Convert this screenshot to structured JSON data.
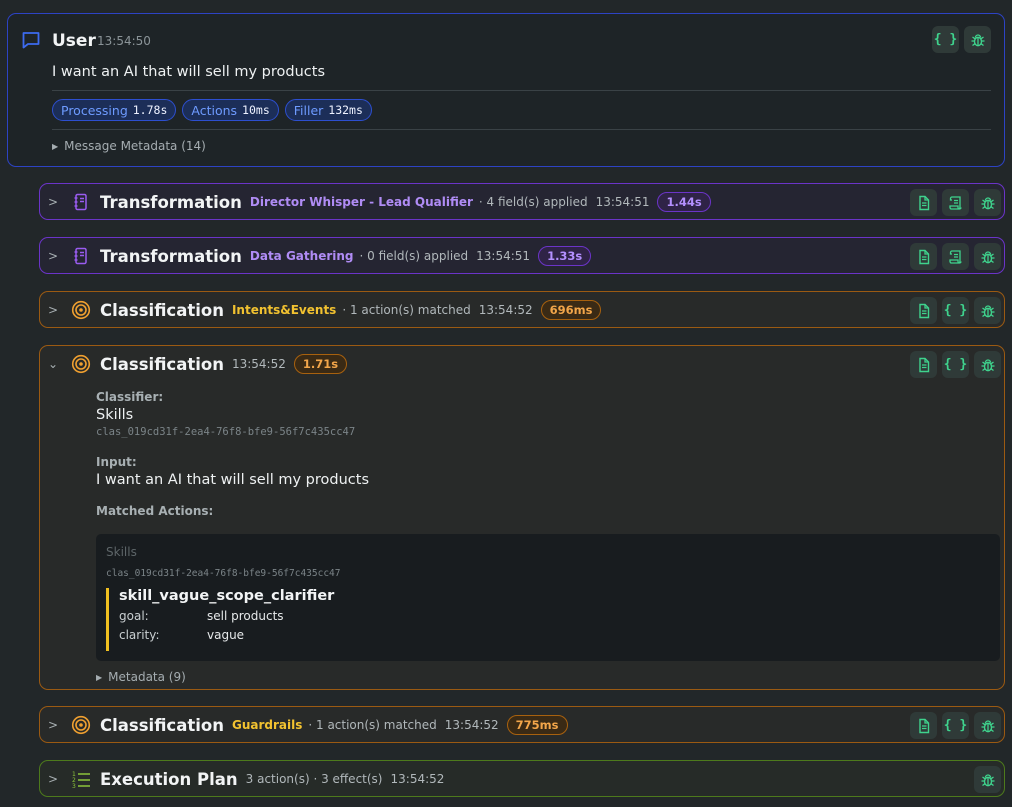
{
  "user": {
    "title": "User",
    "time": "13:54:50",
    "message": "I want an AI that will sell my products",
    "pills": [
      {
        "label": "Processing",
        "value": "1.78s"
      },
      {
        "label": "Actions",
        "value": "10ms"
      },
      {
        "label": "Filler",
        "value": "132ms"
      }
    ],
    "metadata_label": "Message Metadata (14)",
    "buttons": [
      "braces-icon",
      "bug-icon"
    ]
  },
  "steps": [
    {
      "title": "Transformation",
      "subtitle": "Director Whisper - Lead Qualifier",
      "info": "· 4 field(s) applied",
      "time": "13:54:51",
      "duration": "1.44s"
    },
    {
      "title": "Transformation",
      "subtitle": "Data Gathering",
      "info": "· 0 field(s) applied",
      "time": "13:54:51",
      "duration": "1.33s"
    },
    {
      "title": "Classification",
      "subtitle": "Intents&Events",
      "info": "· 1 action(s) matched",
      "time": "13:54:52",
      "duration": "696ms"
    },
    {
      "title": "Classification",
      "time": "13:54:52",
      "duration": "1.71s"
    },
    {
      "title": "Classification",
      "subtitle": "Guardrails",
      "info": "· 1 action(s) matched",
      "time": "13:54:52",
      "duration": "775ms"
    },
    {
      "title": "Execution Plan",
      "info": "3 action(s) · 3 effect(s)",
      "time": "13:54:52"
    }
  ],
  "expanded": {
    "classifier_label": "Classifier:",
    "classifier_name": "Skills",
    "classifier_id": "clas_019cd31f-2ea4-76f8-bfe9-56f7c435cc47",
    "input_label": "Input:",
    "input_value": "I want an AI that will sell my products",
    "matched_label": "Matched Actions:",
    "matched": {
      "group": "Skills",
      "id": "clas_019cd31f-2ea4-76f8-bfe9-56f7c435cc47",
      "skill": "skill_vague_scope_clarifier",
      "params": [
        {
          "key": "goal:",
          "value": "sell products"
        },
        {
          "key": "clarity:",
          "value": "vague"
        }
      ]
    },
    "metadata_label": "Metadata (9)"
  },
  "colors": {
    "user_border": "#2d43c4",
    "transformation": "#6b34c8",
    "classification": "#9b5a12",
    "execution": "#4d7a1c",
    "button_icon": "#3fd38d",
    "accent_yellow": "#f2c230"
  }
}
